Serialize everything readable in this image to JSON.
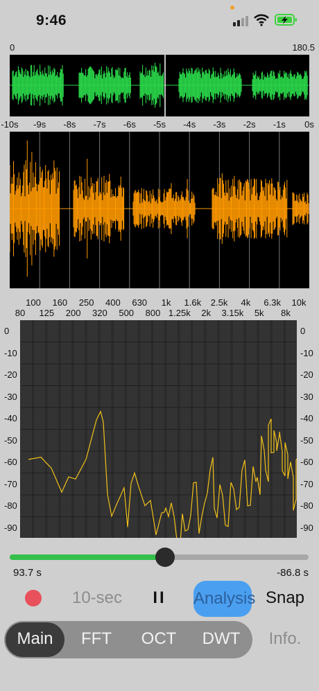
{
  "status": {
    "time": "9:46",
    "icons": [
      "cellular-icon",
      "wifi-icon",
      "battery-charging-icon"
    ],
    "battery_color": "#3bd33b"
  },
  "overview": {
    "left_label": "0",
    "right_label": "180.5",
    "wave_color": "#2bd84a"
  },
  "timeline": {
    "labels": [
      "-10s",
      "-9s",
      "-8s",
      "-7s",
      "-6s",
      "-5s",
      "-4s",
      "-3s",
      "-2s",
      "-1s",
      "0s"
    ]
  },
  "waveform": {
    "color": "#ff9a00"
  },
  "spectrum": {
    "freq_top": [
      "100",
      "160",
      "250",
      "400",
      "630",
      "1k",
      "1.6k",
      "2.5k",
      "4k",
      "6.3k",
      "10k"
    ],
    "freq_bottom": [
      "80",
      "125",
      "200",
      "320",
      "500",
      "800",
      "1.25k",
      "2k",
      "3.15k",
      "5k",
      "8k"
    ],
    "db_labels": [
      "0",
      "-10",
      "-20",
      "-30",
      "-40",
      "-50",
      "-60",
      "-70",
      "-80",
      "-90"
    ],
    "line_color": "#f2c21a"
  },
  "player": {
    "position": "93.7 s",
    "remaining": "-86.8 s",
    "progress": 0.52,
    "track_color": "#35c04b"
  },
  "controls": {
    "record_color": "#e8505b",
    "duration": "10-sec",
    "pause": "II",
    "analysis": "Analysis",
    "snap": "Snap",
    "analysis_color": "#4a9ff0"
  },
  "tabs": {
    "items": [
      "Main",
      "FFT",
      "OCT",
      "DWT"
    ],
    "active": 0,
    "info": "Info."
  }
}
